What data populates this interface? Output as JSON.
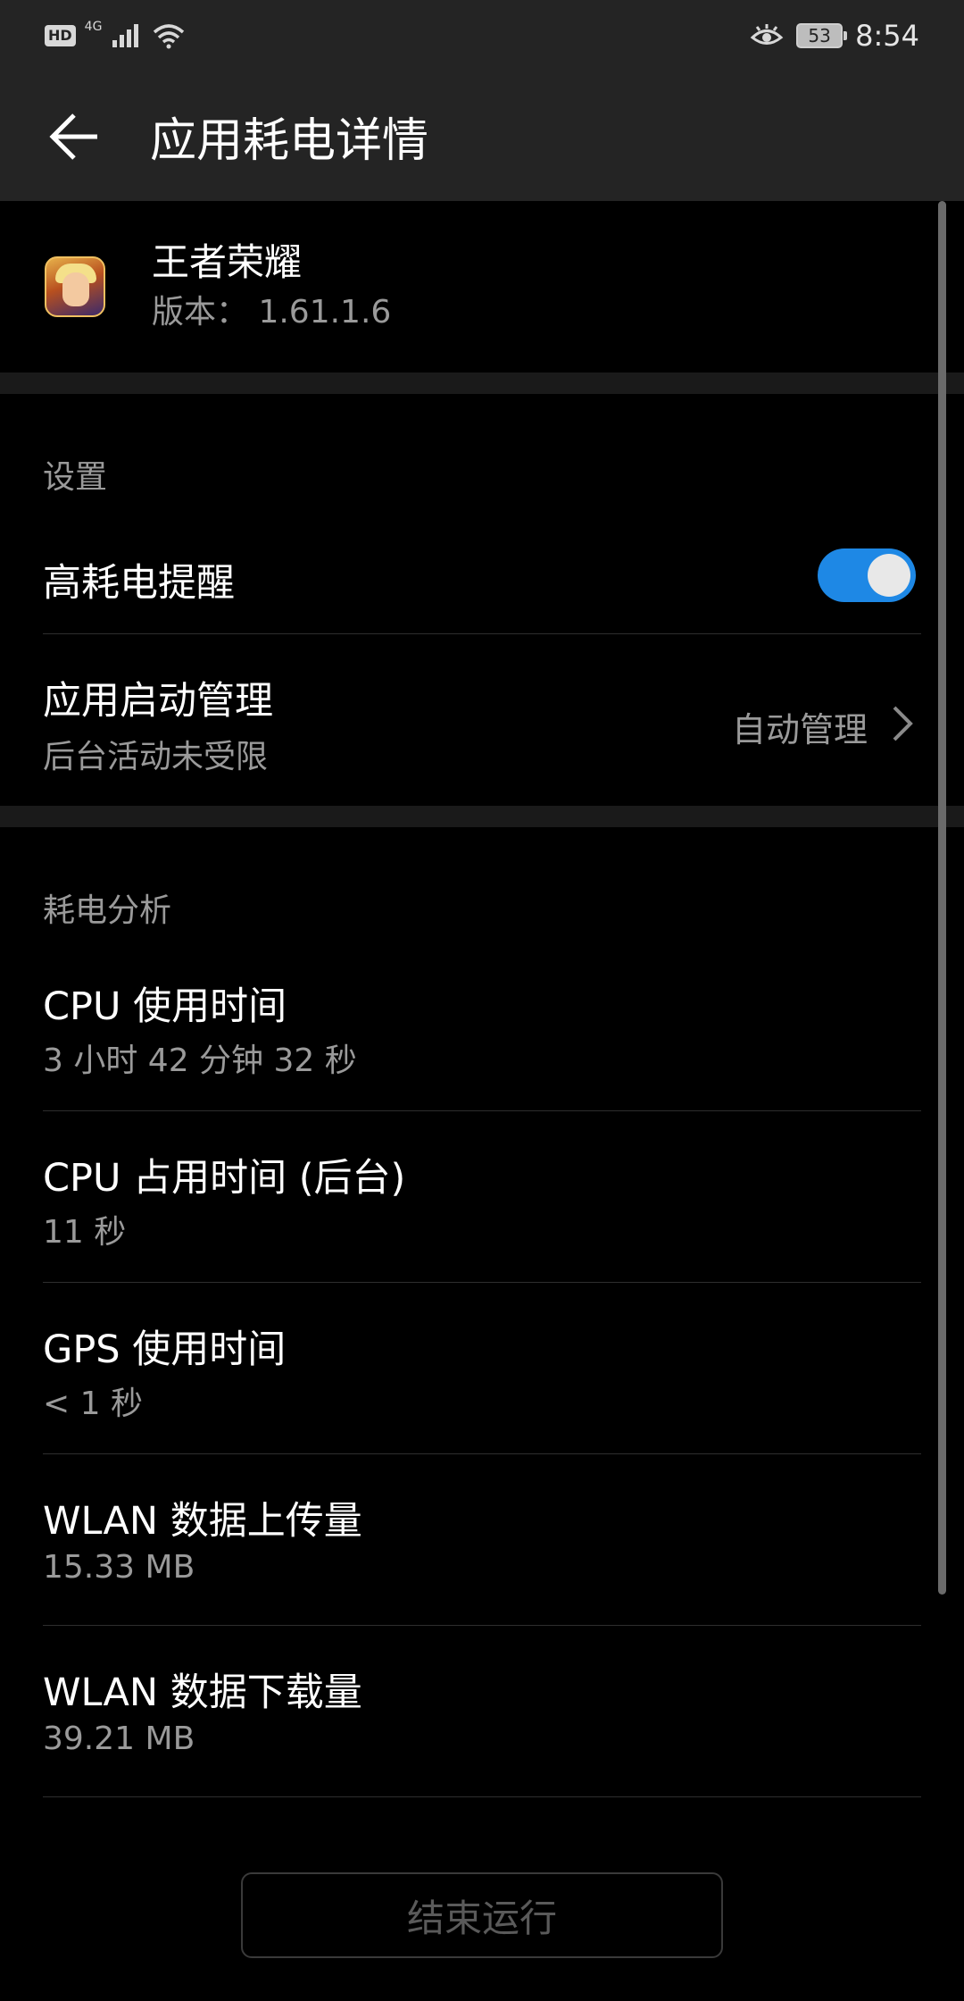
{
  "status_bar": {
    "hd": "HD",
    "network": "4G",
    "time": "8:54",
    "battery": "53"
  },
  "toolbar": {
    "title": "应用耗电详情"
  },
  "app": {
    "name": "王者荣耀",
    "version": "版本： 1.61.1.6"
  },
  "settings": {
    "section_title": "设置",
    "high_power_alert": {
      "label": "高耗电提醒",
      "enabled": true
    },
    "launch_management": {
      "label": "应用启动管理",
      "sub": "后台活动未受限",
      "value": "自动管理"
    }
  },
  "analysis": {
    "section_title": "耗电分析",
    "items": [
      {
        "label": "CPU 使用时间",
        "value": "3 小时 42 分钟 32 秒"
      },
      {
        "label": "CPU 占用时间 (后台)",
        "value": "11 秒"
      },
      {
        "label": "GPS 使用时间",
        "value": "< 1 秒"
      },
      {
        "label": "WLAN 数据上传量",
        "value": "15.33 MB"
      },
      {
        "label": "WLAN 数据下载量",
        "value": "39.21 MB"
      }
    ]
  },
  "actions": {
    "end_label": "结束运行"
  },
  "colors": {
    "accent": "#1e88e5",
    "toolbar_bg": "#242424",
    "secondary_text": "#9a9a9a"
  }
}
